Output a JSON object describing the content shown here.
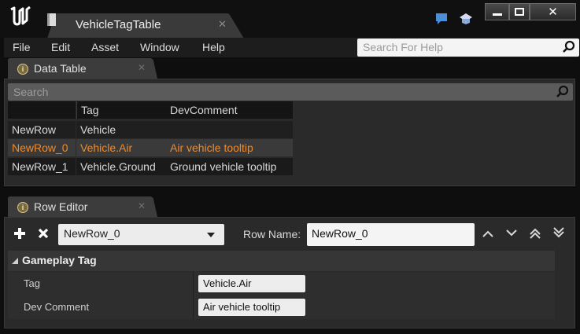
{
  "window": {
    "document_tab": "VehicleTagTable"
  },
  "menu": {
    "items": [
      "File",
      "Edit",
      "Asset",
      "Window",
      "Help"
    ],
    "help_search_placeholder": "Search For Help"
  },
  "data_table_panel": {
    "tab_label": "Data Table",
    "search_placeholder": "Search",
    "columns": [
      "",
      "Tag",
      "DevComment"
    ],
    "rows": [
      {
        "name": "NewRow",
        "tag": "Vehicle",
        "comment": ""
      },
      {
        "name": "NewRow_0",
        "tag": "Vehicle.Air",
        "comment": "Air vehicle tooltip",
        "selected": true
      },
      {
        "name": "NewRow_1",
        "tag": "Vehicle.Ground",
        "comment": "Ground vehicle tooltip"
      }
    ]
  },
  "row_editor_panel": {
    "tab_label": "Row Editor",
    "selected_row": "NewRow_0",
    "row_name_label": "Row Name:",
    "row_name_value": "NewRow_0",
    "category": "Gameplay Tag",
    "properties": [
      {
        "label": "Tag",
        "value": "Vehicle.Air"
      },
      {
        "label": "Dev Comment",
        "value": "Air vehicle tooltip"
      }
    ]
  },
  "colors": {
    "selected_row_text": "#f08a2a",
    "panel_bg": "#2a2a2a",
    "title_bg": "#101010"
  }
}
